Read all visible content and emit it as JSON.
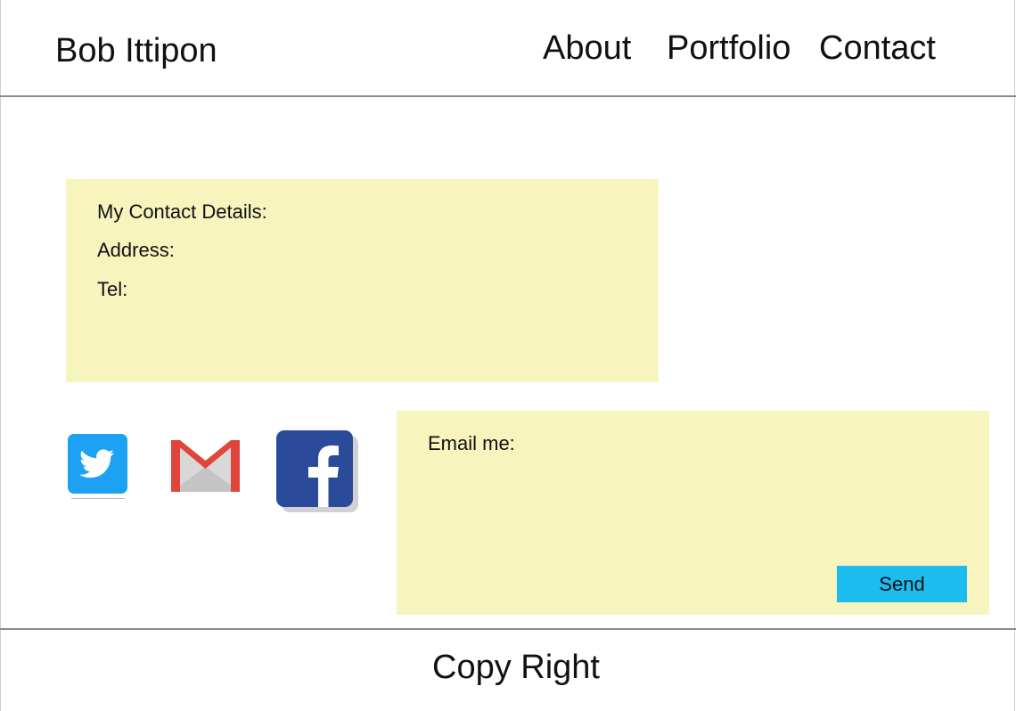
{
  "header": {
    "brand": "Bob Ittipon",
    "nav": {
      "about": "About",
      "portfolio": "Portfolio",
      "contact": "Contact"
    }
  },
  "contact_details": {
    "heading": "My Contact Details:",
    "address_label": "Address:",
    "tel_label": "Tel:"
  },
  "social_icons": [
    "twitter-icon",
    "gmail-icon",
    "facebook-icon"
  ],
  "email_form": {
    "label": "Email me:",
    "send_label": "Send"
  },
  "footer": {
    "copyright": "Copy Right"
  },
  "colors": {
    "panel_background": "#f7f4be",
    "send_button": "#1cbcee",
    "rule": "#8a8a8a",
    "twitter_blue": "#1da1f2",
    "gmail_red": "#e0443a",
    "facebook_blue": "#2a4b9a"
  }
}
